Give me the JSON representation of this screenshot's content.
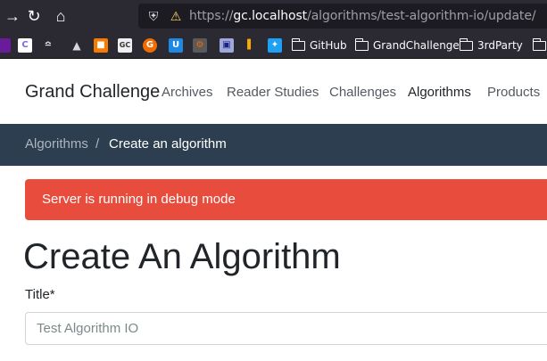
{
  "browser": {
    "url": {
      "scheme": "https://",
      "host": "gc.localhost",
      "path": "/algorithms/test-algorithm-io/update/"
    },
    "nav_icons": [
      "forward-arrow-icon",
      "reload-icon",
      "home-icon"
    ],
    "url_icons": [
      "shield-icon",
      "insecure-lock-icon"
    ],
    "bookmarks": {
      "icons": [
        {
          "name": "bookmark-clickup-icon",
          "glyph": "C",
          "color": "#7b68ee"
        },
        {
          "name": "bookmark-antenna-icon",
          "glyph": "▲",
          "color": "#2b2a33"
        },
        {
          "name": "bookmark-arrow-icon",
          "glyph": "▲",
          "color": "#2b2a33"
        },
        {
          "name": "bookmark-box-icon",
          "glyph": "■",
          "color": "#f57c00"
        },
        {
          "name": "bookmark-gc-icon",
          "glyph": "GC",
          "color": "#f0f0f0"
        },
        {
          "name": "bookmark-orange-g-icon",
          "glyph": "G",
          "color": "#ef6c00"
        },
        {
          "name": "bookmark-u-icon",
          "glyph": "U",
          "color": "#1e88e5"
        },
        {
          "name": "bookmark-grafana-icon",
          "glyph": "⚙",
          "color": "#f46800"
        },
        {
          "name": "bookmark-store-icon",
          "glyph": "▣",
          "color": "#9fa8da"
        },
        {
          "name": "bookmark-analytics-icon",
          "glyph": "▐",
          "color": "#f9ab00"
        },
        {
          "name": "bookmark-twitter-icon",
          "glyph": "✉",
          "color": "#1da1f2"
        }
      ],
      "folders": [
        "GitHub",
        "GrandChallenge",
        "3rdParty"
      ]
    }
  },
  "site": {
    "brand": "Grand Challenge",
    "nav": [
      "Archives",
      "Reader Studies",
      "Challenges",
      "Algorithms",
      "Products"
    ],
    "active_nav": "Algorithms"
  },
  "breadcrumb": {
    "parent": "Algorithms",
    "separator": "/",
    "current": "Create an algorithm"
  },
  "alert": {
    "message": "Server is running in debug mode",
    "color": "#e74c3c"
  },
  "page": {
    "title": "Create An Algorithm",
    "form": {
      "title_label": "Title*",
      "title_value": "Test Algorithm IO"
    }
  }
}
